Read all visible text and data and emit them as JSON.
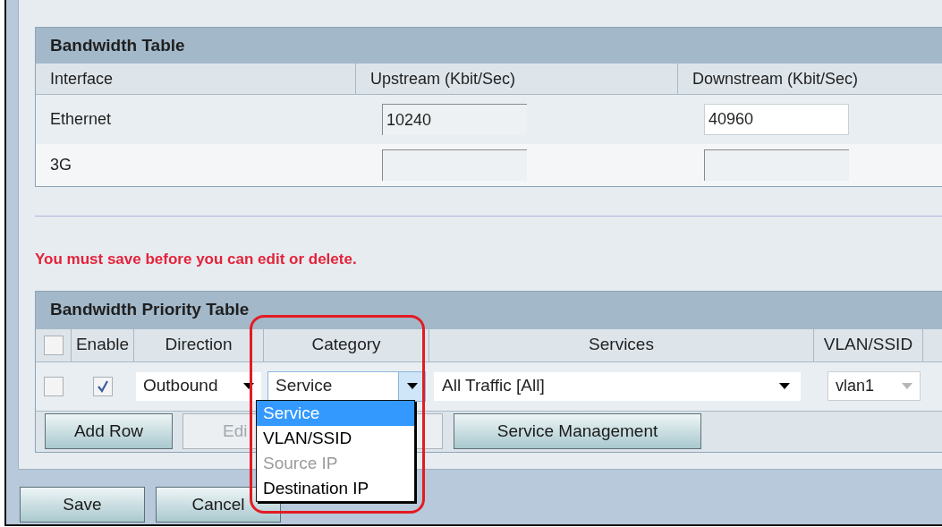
{
  "bandwidth_table": {
    "title": "Bandwidth Table",
    "columns": [
      "Interface",
      "Upstream (Kbit/Sec)",
      "Downstream (Kbit/Sec)"
    ],
    "rows": [
      {
        "interface": "Ethernet",
        "upstream": {
          "value": "10240",
          "disabled": true
        },
        "downstream": {
          "value": "40960",
          "disabled": false
        }
      },
      {
        "interface": "3G",
        "upstream": {
          "disabled": true
        },
        "downstream": {
          "disabled": true
        }
      }
    ]
  },
  "notice": "You must save before you can edit or delete.",
  "priority_table": {
    "title": "Bandwidth Priority Table",
    "select_all_checked": false,
    "columns": [
      "Enable",
      "Direction",
      "Category",
      "Services",
      "VLAN/SSID"
    ],
    "rows": [
      {
        "selected": false,
        "enable": true,
        "direction": "Outbound",
        "category": "Service",
        "services": "All Traffic [All]",
        "vlan": "vlan1",
        "vlan_disabled": true
      }
    ],
    "buttons": [
      {
        "label": "Add Row",
        "disabled": false
      },
      {
        "label": "Edi",
        "disabled": true
      },
      {
        "label": "Service Management",
        "disabled": false
      }
    ]
  },
  "category_dropdown": {
    "expanded": true,
    "options": [
      {
        "label": "Service",
        "selected": true,
        "disabled": false
      },
      {
        "label": "VLAN/SSID",
        "selected": false,
        "disabled": false
      },
      {
        "label": "Source IP",
        "selected": false,
        "disabled": true
      },
      {
        "label": "Destination IP",
        "selected": false,
        "disabled": false
      }
    ]
  },
  "buttons": [
    "Save",
    "Cancel"
  ]
}
